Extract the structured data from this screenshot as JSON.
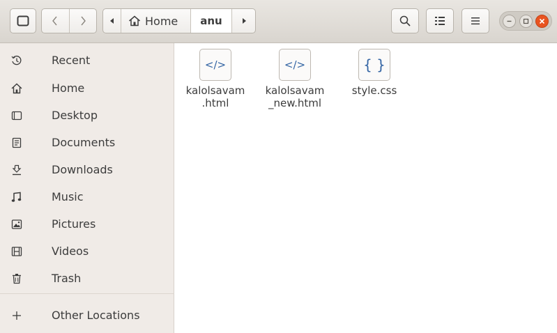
{
  "header": {
    "path": {
      "home_label": "Home",
      "current": "anu"
    },
    "icons": {
      "sidebar_toggle": "sidebar-toggle-icon",
      "back": "chevron-left-icon",
      "forward": "chevron-right-icon",
      "home": "home-icon",
      "search": "search-icon",
      "view": "list-view-icon",
      "menu": "hamburger-icon"
    }
  },
  "sidebar": {
    "items": [
      {
        "label": "Recent",
        "icon": "clock-icon"
      },
      {
        "label": "Home",
        "icon": "home-icon"
      },
      {
        "label": "Desktop",
        "icon": "desktop-icon"
      },
      {
        "label": "Documents",
        "icon": "document-icon"
      },
      {
        "label": "Downloads",
        "icon": "download-icon"
      },
      {
        "label": "Music",
        "icon": "music-icon"
      },
      {
        "label": "Pictures",
        "icon": "picture-icon"
      },
      {
        "label": "Videos",
        "icon": "film-icon"
      },
      {
        "label": "Trash",
        "icon": "trash-icon"
      }
    ],
    "other": {
      "label": "Other Locations",
      "icon": "plus-icon"
    }
  },
  "files": [
    {
      "name": "kalolsavam\n.html",
      "glyph": "</>"
    },
    {
      "name": "kalolsavam\n_new.html",
      "glyph": "</>"
    },
    {
      "name": "style.css",
      "glyph": "{ }"
    }
  ],
  "colors": {
    "accent_close": "#e95420",
    "sidebar_bg": "#f0ebe7",
    "header_bg": "#dfdbd5",
    "icon_blue": "#3465a4"
  }
}
